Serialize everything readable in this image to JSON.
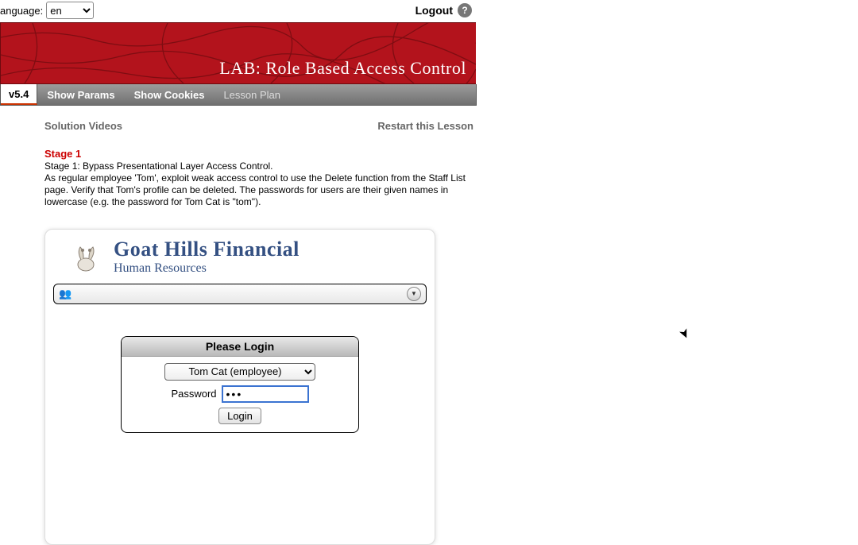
{
  "topbar": {
    "language_label": "anguage:",
    "language_value": "en",
    "logout": "Logout",
    "help_glyph": "?"
  },
  "banner": {
    "title": "LAB: Role Based Access Control"
  },
  "tabs": {
    "version": "v5.4",
    "show_params": "Show Params",
    "show_cookies": "Show Cookies",
    "lesson_plan": "Lesson Plan"
  },
  "links": {
    "solution": "Solution Videos",
    "restart": "Restart this Lesson"
  },
  "stage": {
    "label": "Stage 1",
    "heading": "Stage 1: Bypass Presentational Layer Access Control.",
    "body": "As regular employee 'Tom', exploit weak access control to use the Delete function from the Staff List page. Verify that Tom's profile can be deleted. The passwords for users are their given names in lowercase (e.g. the password for Tom Cat is \"tom\")."
  },
  "brand": {
    "line1": "Goat Hills Financial",
    "line2": "Human Resources"
  },
  "wide_dropdown": {
    "icon": "👥",
    "arrow": "▼"
  },
  "login": {
    "title": "Please Login",
    "employee_selected": "Tom Cat (employee)",
    "password_label": "Password",
    "password_value": "•••",
    "button": "Login"
  }
}
